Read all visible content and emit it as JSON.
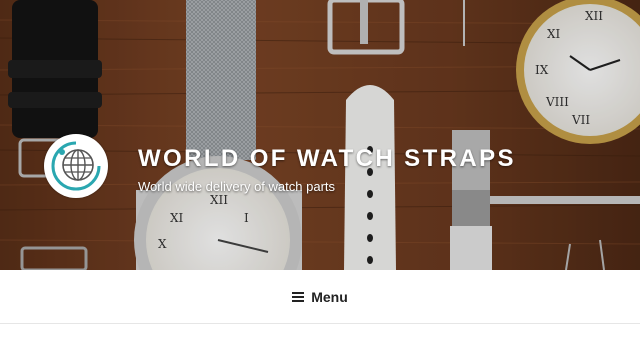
{
  "header": {
    "site_title": "WORLD OF WATCH STRAPS",
    "site_description": "World wide delivery of watch parts",
    "background_description_icons": [
      "watch-straps-photo"
    ],
    "colors": {
      "title": "#ffffff",
      "wood": "#7a4424"
    }
  },
  "nav": {
    "menu_label": "Menu",
    "menu_icon": "hamburger-icon"
  }
}
